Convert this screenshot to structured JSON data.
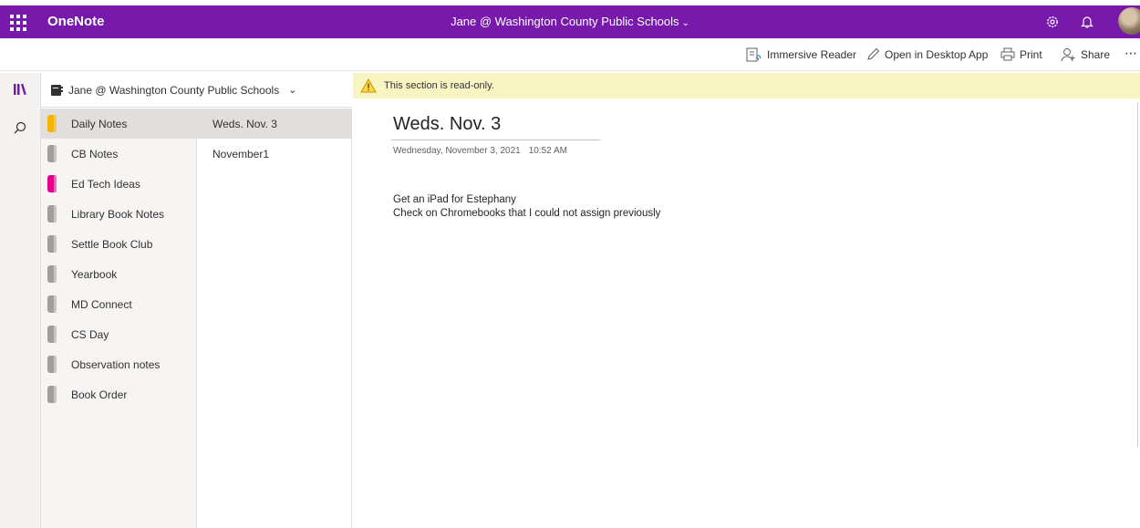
{
  "app": {
    "name": "OneNote",
    "account": "Jane @ Washington County Public Schools",
    "brand_color": "#7719aa"
  },
  "topbar_icons": [
    "waffle-icon",
    "settings-gear-icon",
    "bell-icon",
    "avatar"
  ],
  "commands": {
    "immersive_reader": "Immersive Reader",
    "open_desktop": "Open in Desktop App",
    "print": "Print",
    "share": "Share",
    "more": "⋯"
  },
  "rail": [
    "notebooks-icon",
    "search-icon"
  ],
  "notebook": {
    "name": "Jane @ Washington County Public Schools"
  },
  "sections": [
    {
      "label": "Daily Notes",
      "color": "#f4b400",
      "selected": true
    },
    {
      "label": "CB Notes",
      "color": "#a19f9d"
    },
    {
      "label": "Ed Tech Ideas",
      "color": "#e3008c"
    },
    {
      "label": "Library Book Notes",
      "color": "#a19f9d"
    },
    {
      "label": "Settle Book Club",
      "color": "#a19f9d"
    },
    {
      "label": "Yearbook",
      "color": "#a19f9d"
    },
    {
      "label": "MD Connect",
      "color": "#a19f9d"
    },
    {
      "label": "CS Day",
      "color": "#a19f9d"
    },
    {
      "label": "Observation notes",
      "color": "#a19f9d"
    },
    {
      "label": "Book Order",
      "color": "#a19f9d"
    }
  ],
  "pages": [
    {
      "label": "Weds. Nov. 3",
      "selected": true
    },
    {
      "label": "November1"
    }
  ],
  "banner": {
    "text": "This section is read-only.",
    "color": "#f9f5c3"
  },
  "page": {
    "title": "Weds. Nov. 3",
    "date": "Wednesday, November 3, 2021",
    "time": "10:52 AM",
    "lines": [
      "Get an iPad for Estephany",
      "Check on Chromebooks that I could not assign previously"
    ]
  }
}
